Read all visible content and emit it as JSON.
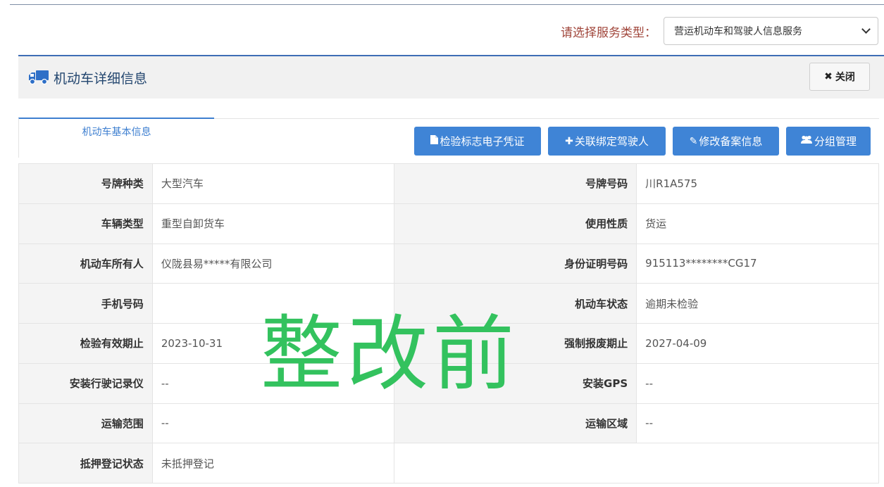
{
  "service": {
    "label": "请选择服务类型：",
    "selected": "营运机动车和驾驶人信息服务"
  },
  "panel": {
    "title": "机动车详细信息",
    "close_label": "关闭"
  },
  "tabs": [
    {
      "label": "机动车基本信息"
    }
  ],
  "actions": [
    {
      "icon": "file-icon",
      "label": "检验标志电子凭证"
    },
    {
      "icon": "plus-icon",
      "label": "关联绑定驾驶人"
    },
    {
      "icon": "pencil-icon",
      "label": "修改备案信息"
    },
    {
      "icon": "users-icon",
      "label": "分组管理"
    }
  ],
  "rows": [
    [
      {
        "label": "号牌种类",
        "value": "大型汽车"
      },
      {
        "label": "号牌号码",
        "value": "川R1A575"
      }
    ],
    [
      {
        "label": "车辆类型",
        "value": "重型自卸货车"
      },
      {
        "label": "使用性质",
        "value": "货运"
      }
    ],
    [
      {
        "label": "机动车所有人",
        "value": "仪陇县易*****有限公司"
      },
      {
        "label": "身份证明号码",
        "value": "915113********CG17"
      }
    ],
    [
      {
        "label": "手机号码",
        "value": ""
      },
      {
        "label": "机动车状态",
        "value": "逾期未检验"
      }
    ],
    [
      {
        "label": "检验有效期止",
        "value": "2023-10-31"
      },
      {
        "label": "强制报废期止",
        "value": "2027-04-09"
      }
    ],
    [
      {
        "label": "安装行驶记录仪",
        "value": "--"
      },
      {
        "label": "安装GPS",
        "value": "--"
      }
    ],
    [
      {
        "label": "运输范围",
        "value": "--"
      },
      {
        "label": "运输区域",
        "value": "--"
      }
    ],
    [
      {
        "label": "抵押登记状态",
        "value": "未抵押登记"
      },
      {
        "label": "",
        "value": ""
      }
    ]
  ],
  "watermark": "整改前",
  "colors": {
    "accent_blue": "#3f84d6",
    "header_border": "#3e6db5",
    "label_red": "#a0453a",
    "watermark_green": "#33c25e"
  }
}
